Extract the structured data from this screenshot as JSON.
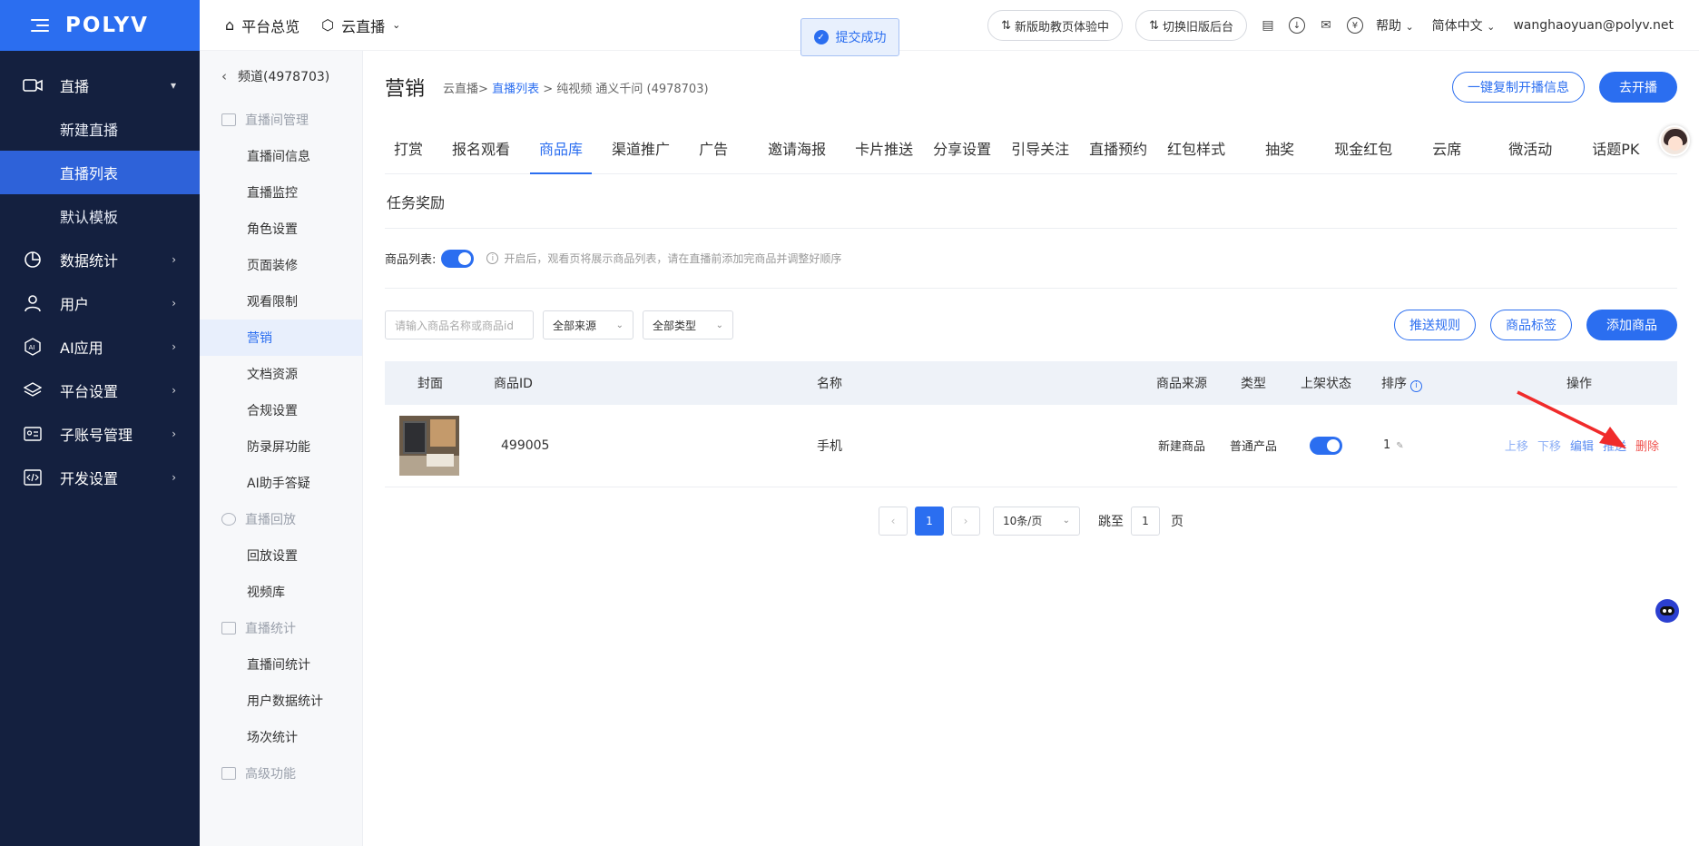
{
  "brand": "POLYV",
  "sidebar": {
    "live_group": "直播",
    "live_items": [
      "新建直播",
      "直播列表",
      "默认模板"
    ],
    "groups": [
      {
        "label": "数据统计",
        "icon": "chart-pie-icon"
      },
      {
        "label": "用户",
        "icon": "user-icon"
      },
      {
        "label": "AI应用",
        "icon": "ai-icon"
      },
      {
        "label": "平台设置",
        "icon": "layers-icon"
      },
      {
        "label": "子账号管理",
        "icon": "id-card-icon"
      },
      {
        "label": "开发设置",
        "icon": "code-icon"
      }
    ]
  },
  "sub_sidebar": {
    "channel": "频道(4978703)",
    "sections": [
      {
        "title": "直播间管理",
        "items": [
          "直播间信息",
          "直播监控",
          "角色设置",
          "页面装修",
          "观看限制",
          "营销",
          "文档资源",
          "合规设置",
          "防录屏功能",
          "AI助手答疑"
        ]
      },
      {
        "title": "直播回放",
        "items": [
          "回放设置",
          "视频库"
        ]
      },
      {
        "title": "直播统计",
        "items": [
          "直播间统计",
          "用户数据统计",
          "场次统计"
        ]
      },
      {
        "title": "高级功能",
        "items": []
      }
    ]
  },
  "topbar": {
    "overview": "平台总览",
    "cloud": "云直播",
    "toast": "提交成功",
    "pill_new": "新版助教页体验中",
    "pill_old": "切换旧版后台",
    "help": "帮助",
    "lang": "简体中文",
    "user": "wanghaoyuan@polyv.net"
  },
  "header": {
    "title": "营销",
    "crumb1": "云直播>",
    "crumb2": "直播列表",
    "crumb3": "> 纯视频 通义千问 (4978703)",
    "copy_btn": "一键复制开播信息",
    "start_btn": "去开播"
  },
  "tabs": [
    "打赏",
    "报名观看",
    "商品库",
    "渠道推广",
    "广告",
    "邀请海报",
    "卡片推送",
    "分享设置",
    "引导关注",
    "直播预约",
    "红包样式",
    "抽奖",
    "现金红包",
    "云席",
    "微活动",
    "话题PK"
  ],
  "tabs_row2": [
    "任务奖励"
  ],
  "switch_row": {
    "label": "商品列表:",
    "hint": "开启后，观看页将展示商品列表，请在直播前添加完商品并调整好顺序"
  },
  "filters": {
    "search_placeholder": "请输入商品名称或商品id",
    "source": "全部来源",
    "type": "全部类型",
    "push_rule": "推送规则",
    "tags": "商品标签",
    "add": "添加商品"
  },
  "table": {
    "headers": [
      "封面",
      "商品ID",
      "名称",
      "商品来源",
      "类型",
      "上架状态",
      "排序",
      "操作"
    ],
    "rows": [
      {
        "id": "499005",
        "name": "手机",
        "source": "新建商品",
        "type": "普通产品",
        "order": "1",
        "ops": [
          "上移",
          "下移",
          "编辑",
          "推送",
          "删除"
        ]
      }
    ]
  },
  "pager": {
    "current": "1",
    "size": "10条/页",
    "goto": "跳至",
    "goto_val": "1",
    "page": "页"
  }
}
